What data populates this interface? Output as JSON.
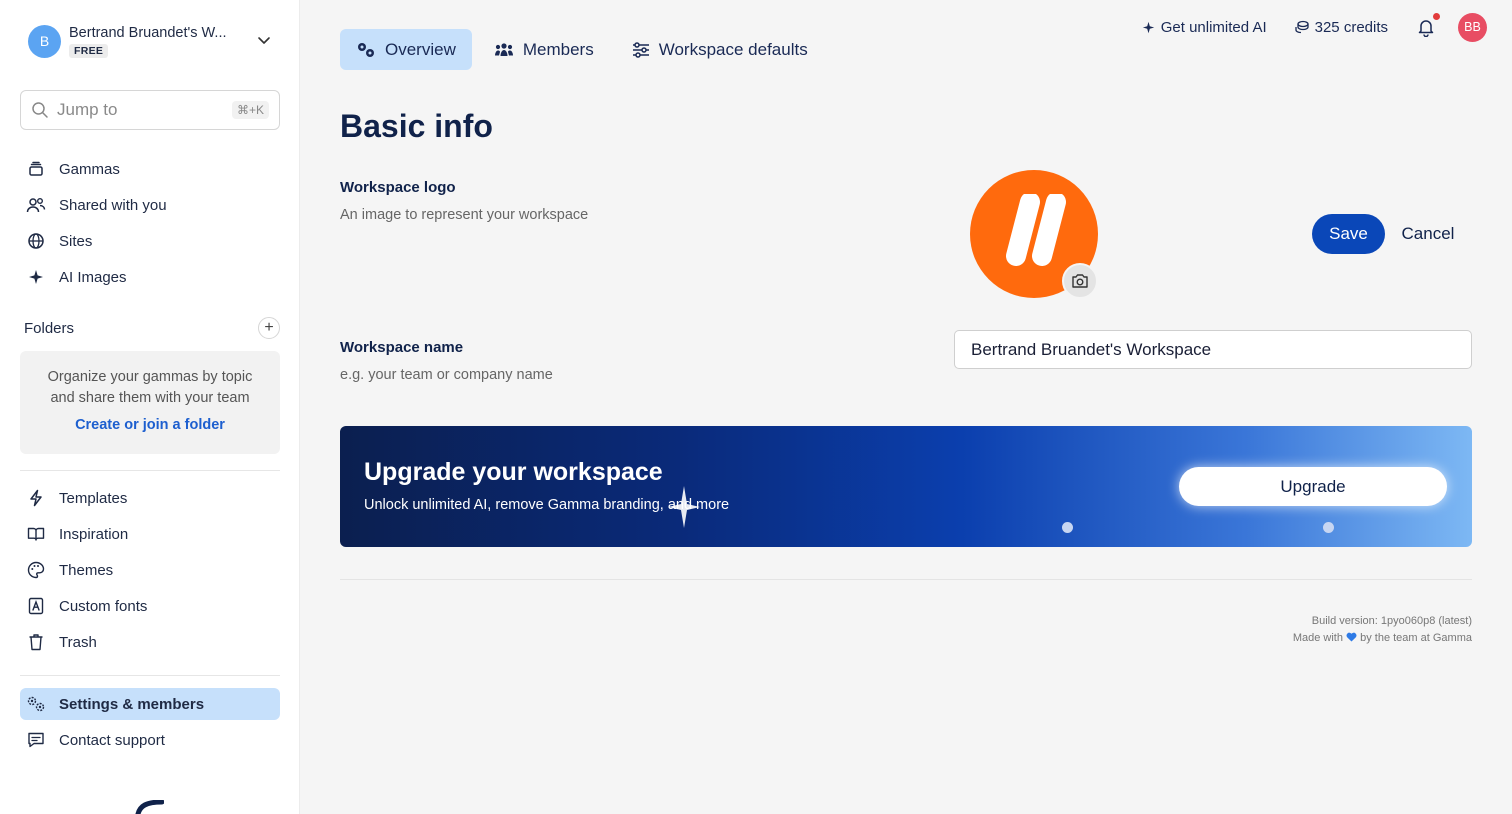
{
  "sidebar": {
    "workspace": {
      "initial": "B",
      "name": "Bertrand Bruandet's W...",
      "plan": "FREE"
    },
    "search": {
      "placeholder": "Jump to",
      "shortcut": "⌘+K"
    },
    "nav_primary": [
      {
        "label": "Gammas",
        "icon": "stack-icon"
      },
      {
        "label": "Shared with you",
        "icon": "users-icon"
      },
      {
        "label": "Sites",
        "icon": "globe-icon"
      },
      {
        "label": "AI Images",
        "icon": "sparkle-icon"
      }
    ],
    "folders": {
      "title": "Folders",
      "description_line1": "Organize your gammas by topic",
      "description_line2": "and share them with your team",
      "cta": "Create or join a folder"
    },
    "nav_secondary": [
      {
        "label": "Templates",
        "icon": "bolt-icon"
      },
      {
        "label": "Inspiration",
        "icon": "book-icon"
      },
      {
        "label": "Themes",
        "icon": "palette-icon"
      },
      {
        "label": "Custom fonts",
        "icon": "font-icon"
      },
      {
        "label": "Trash",
        "icon": "trash-icon"
      }
    ],
    "nav_bottom": [
      {
        "label": "Settings & members",
        "icon": "settings-icon",
        "active": true
      },
      {
        "label": "Contact support",
        "icon": "chat-icon"
      }
    ]
  },
  "tabs": [
    {
      "label": "Overview",
      "icon": "gears-icon",
      "active": true
    },
    {
      "label": "Members",
      "icon": "people-icon"
    },
    {
      "label": "Workspace defaults",
      "icon": "sliders-icon"
    }
  ],
  "topbar": {
    "ai_cta": "Get unlimited AI",
    "credits": "325 credits",
    "user_initials": "BB"
  },
  "main": {
    "title": "Basic info",
    "logo_field": {
      "label": "Workspace logo",
      "help": "An image to represent your workspace"
    },
    "save_label": "Save",
    "cancel_label": "Cancel",
    "name_field": {
      "label": "Workspace name",
      "help": "e.g. your team or company name",
      "value": "Bertrand Bruandet's Workspace"
    },
    "upgrade": {
      "title": "Upgrade your workspace",
      "subtitle": "Unlock unlimited AI, remove Gamma branding, and more",
      "button": "Upgrade"
    },
    "footer": {
      "build": "Build version: 1pyo060p8 (latest)",
      "made_with_prefix": "Made with",
      "made_with_suffix": "by the team at Gamma"
    }
  },
  "colors": {
    "accent": "#0a47b8",
    "active_bg": "#c6e0fb",
    "logo_orange": "#ff6a0d",
    "avatar_red": "#e84d63"
  }
}
